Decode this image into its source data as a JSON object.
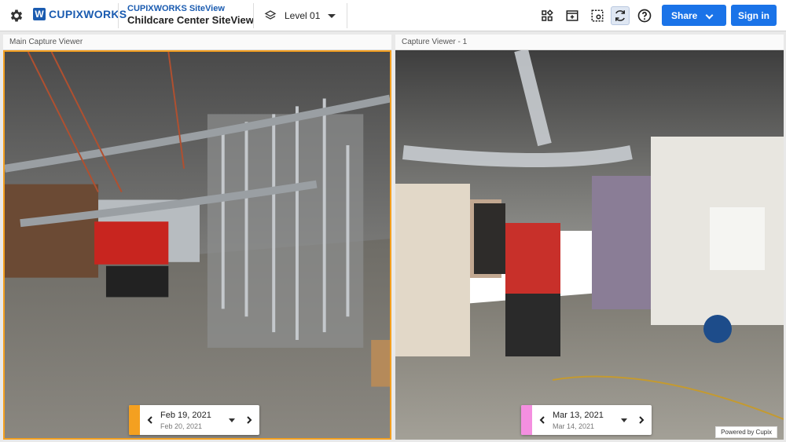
{
  "header": {
    "logo_text": "CUPIXWORKS",
    "logo_mark": "W",
    "product_name": "CUPIXWORKS SiteView",
    "project_name": "Childcare Center SiteView",
    "level_label": "Level 01",
    "share_label": "Share",
    "signin_label": "Sign in",
    "tools": [
      {
        "icon": "compare-layout-icon"
      },
      {
        "icon": "add-view-icon"
      },
      {
        "icon": "screenshot-icon"
      },
      {
        "icon": "sync-icon",
        "active": true
      },
      {
        "icon": "help-icon"
      }
    ]
  },
  "panels": {
    "main": {
      "title": "Main Capture Viewer",
      "date_main": "Feb 19, 2021",
      "date_sub": "Feb 20, 2021",
      "color": "#f4a020"
    },
    "secondary": {
      "title": "Capture Viewer - 1",
      "date_main": "Mar 13, 2021",
      "date_sub": "Mar 14, 2021",
      "color": "#f48fe0"
    }
  },
  "footer": {
    "powered_by": "Powered by Cupix"
  },
  "colors": {
    "brand_blue": "#1a73e8",
    "main_highlight": "#f4a020"
  }
}
